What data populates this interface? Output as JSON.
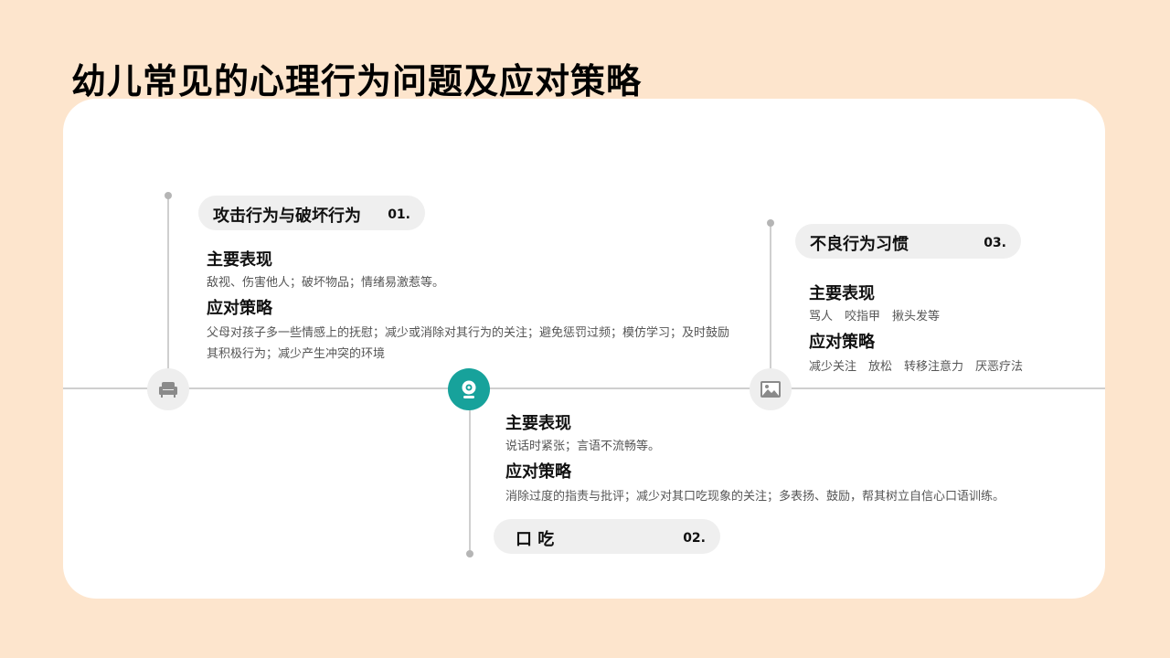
{
  "title": "幼儿常见的心理行为问题及应对策略",
  "items": [
    {
      "title": "攻击行为与破坏行为",
      "num": "01.",
      "icon": "sofa-icon",
      "heading1": "主要表现",
      "text1": "敌视、伤害他人；破坏物品；情绪易激惹等。",
      "heading2": "应对策略",
      "text2": "父母对孩子多一些情感上的抚慰；减少或消除对其行为的关注；避免惩罚过频；模仿学习；及时鼓励其积极行为；减少产生冲突的环境"
    },
    {
      "title": "口 吃",
      "num": "02.",
      "icon": "webcam-icon",
      "heading1": "主要表现",
      "text1": "说话时紧张；言语不流畅等。",
      "heading2": "应对策略",
      "text2": "消除过度的指责与批评；减少对其口吃现象的关注；多表扬、鼓励，帮其树立自信心口语训练。"
    },
    {
      "title": "不良行为习惯",
      "num": "03.",
      "icon": "image-icon",
      "heading1": "主要表现",
      "text1": "骂人　咬指甲　揪头发等",
      "heading2": "应对策略",
      "text2": "减少关注　放松　转移注意力　厌恶疗法"
    }
  ],
  "colors": {
    "background": "#fde5cd",
    "card": "#ffffff",
    "accent": "#17a29b",
    "pill": "#efefef",
    "line": "#cfcfcf"
  }
}
